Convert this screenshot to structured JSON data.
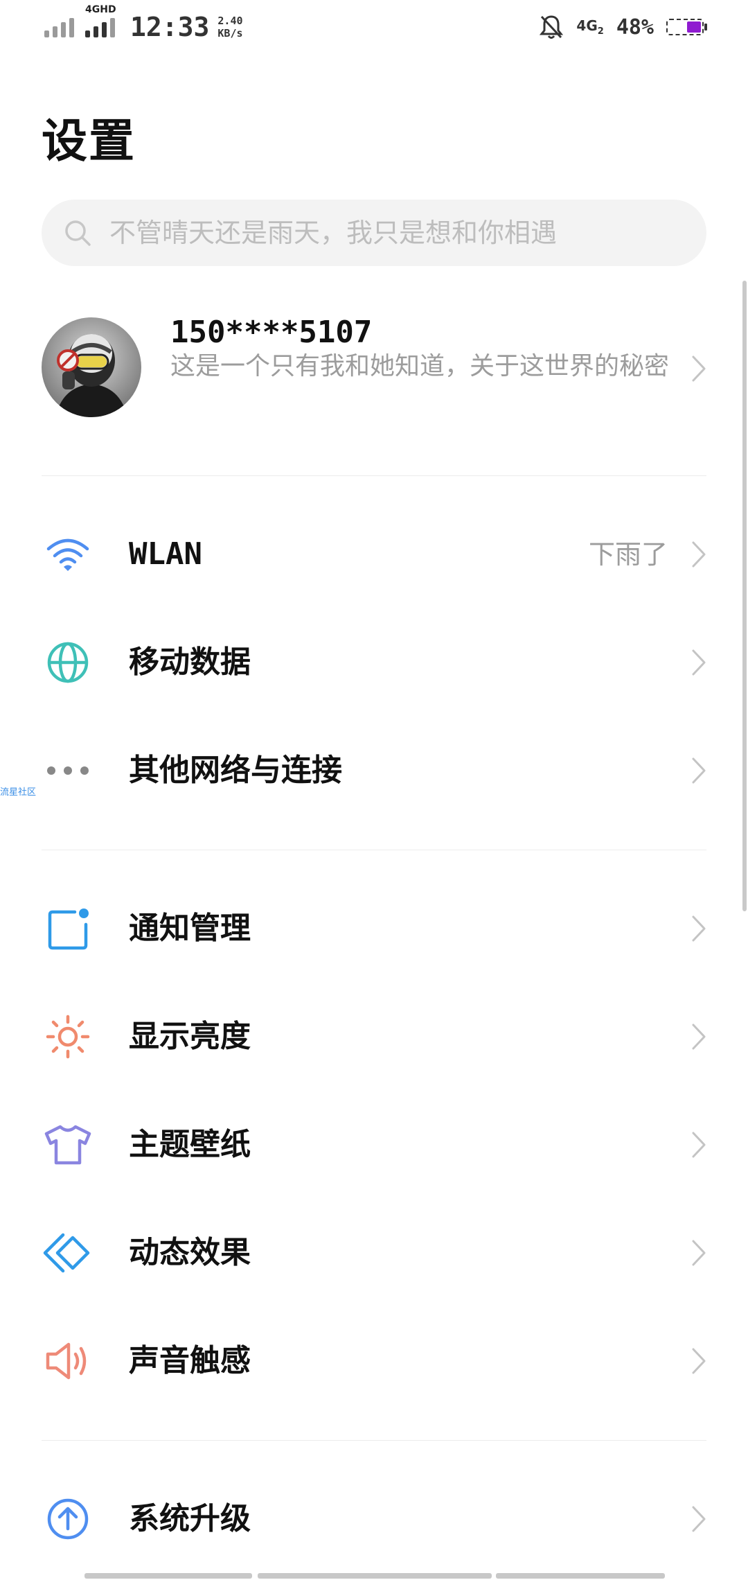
{
  "status_bar": {
    "net_tag": "4GHD",
    "time": "12:33",
    "speed_value": "2.40",
    "speed_unit": "KB/s",
    "net_right": "4G",
    "net_right_sub": "2",
    "battery_percent": "48%",
    "battery_fill_color": "#8f1bd0"
  },
  "page": {
    "title": "设置"
  },
  "search": {
    "placeholder": "不管晴天还是雨天，我只是想和你相遇"
  },
  "profile": {
    "name": "150****5107",
    "signature": "这是一个只有我和她知道，关于这世界的秘密"
  },
  "edge_tag": "流星社区",
  "sections": [
    {
      "rows": [
        {
          "label": "WLAN",
          "value": "下雨了",
          "icon": "wifi-icon",
          "color": "#4f8ef0"
        },
        {
          "label": "移动数据",
          "value": "",
          "icon": "globe-icon",
          "color": "#3fc0b7"
        },
        {
          "label": "其他网络与连接",
          "value": "",
          "icon": "more-dots-icon",
          "color": "#888888"
        }
      ]
    },
    {
      "rows": [
        {
          "label": "通知管理",
          "value": "",
          "icon": "notification-icon",
          "color": "#2f9ae8"
        },
        {
          "label": "显示亮度",
          "value": "",
          "icon": "brightness-icon",
          "color": "#f08a6d"
        },
        {
          "label": "主题壁纸",
          "value": "",
          "icon": "theme-shirt-icon",
          "color": "#8a85e0"
        },
        {
          "label": "动态效果",
          "value": "",
          "icon": "dynamic-effect-icon",
          "color": "#2f9ae8"
        },
        {
          "label": "声音触感",
          "value": "",
          "icon": "sound-icon",
          "color": "#ee8a78"
        }
      ]
    },
    {
      "rows": [
        {
          "label": "系统升级",
          "value": "",
          "icon": "system-upgrade-icon",
          "color": "#4f8ef0"
        }
      ]
    }
  ]
}
